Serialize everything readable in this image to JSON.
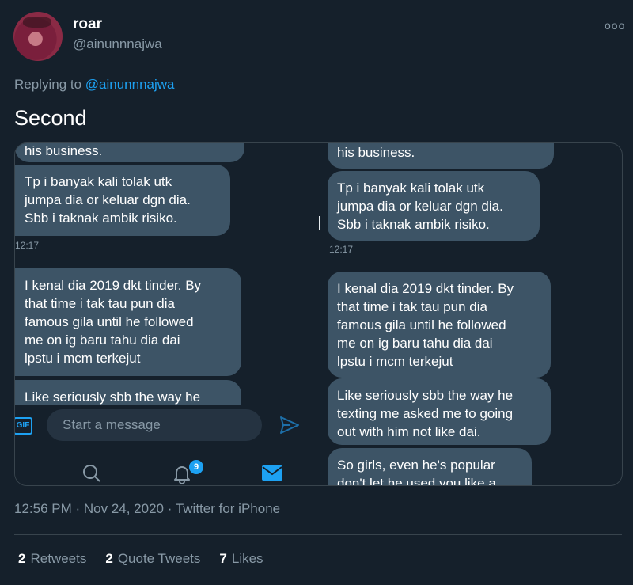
{
  "author": {
    "name": "roar",
    "handle": "@ainunnnajwa",
    "more_icon": "ooo"
  },
  "reply": {
    "prefix": "Replying to ",
    "to": "@ainunnnajwa"
  },
  "tweet": {
    "text": "Second"
  },
  "left_screenshot": {
    "bubble_top": "his business.",
    "bubble_1": "Tp i banyak kali tolak utk\njumpa dia or keluar dgn dia.\nSbb i taknak ambik risiko.",
    "timestamp": "12:17",
    "bubble_2": "I kenal dia 2019 dkt tinder. By\nthat time i tak tau pun dia\nfamous gila until he followed\nme on ig baru tahu dia dai\nlpstu i mcm terkejut",
    "bubble_3": "Like seriously sbb the way he",
    "gif_label": "GIF",
    "message_placeholder": "Start a message",
    "notification_count": "9"
  },
  "right_screenshot": {
    "bubble_top": "his business.",
    "bubble_1": "Tp i banyak kali tolak utk\njumpa dia or keluar dgn dia.\nSbb i taknak ambik risiko.",
    "timestamp": "12:17",
    "bubble_2": "I kenal dia 2019 dkt tinder. By\nthat time i tak tau pun dia\nfamous gila until he followed\nme on ig baru tahu dia dai\nlpstu i mcm terkejut",
    "bubble_3": "Like seriously sbb the way he\ntexting me asked me to going\nout with him not like dai.",
    "bubble_4": "So girls, even he's popular\ndon't let he used you like a"
  },
  "meta": {
    "time": "12:56 PM",
    "date": "Nov 24, 2020",
    "source": "Twitter for iPhone",
    "separator": " · "
  },
  "stats": {
    "retweets_count": "2",
    "retweets_label": "Retweets",
    "quotes_count": "2",
    "quotes_label": "Quote Tweets",
    "likes_count": "7",
    "likes_label": "Likes"
  },
  "colors": {
    "background": "#15202b",
    "accent": "#1da1f2",
    "muted": "#8899a6",
    "bubble": "#3d5466"
  }
}
